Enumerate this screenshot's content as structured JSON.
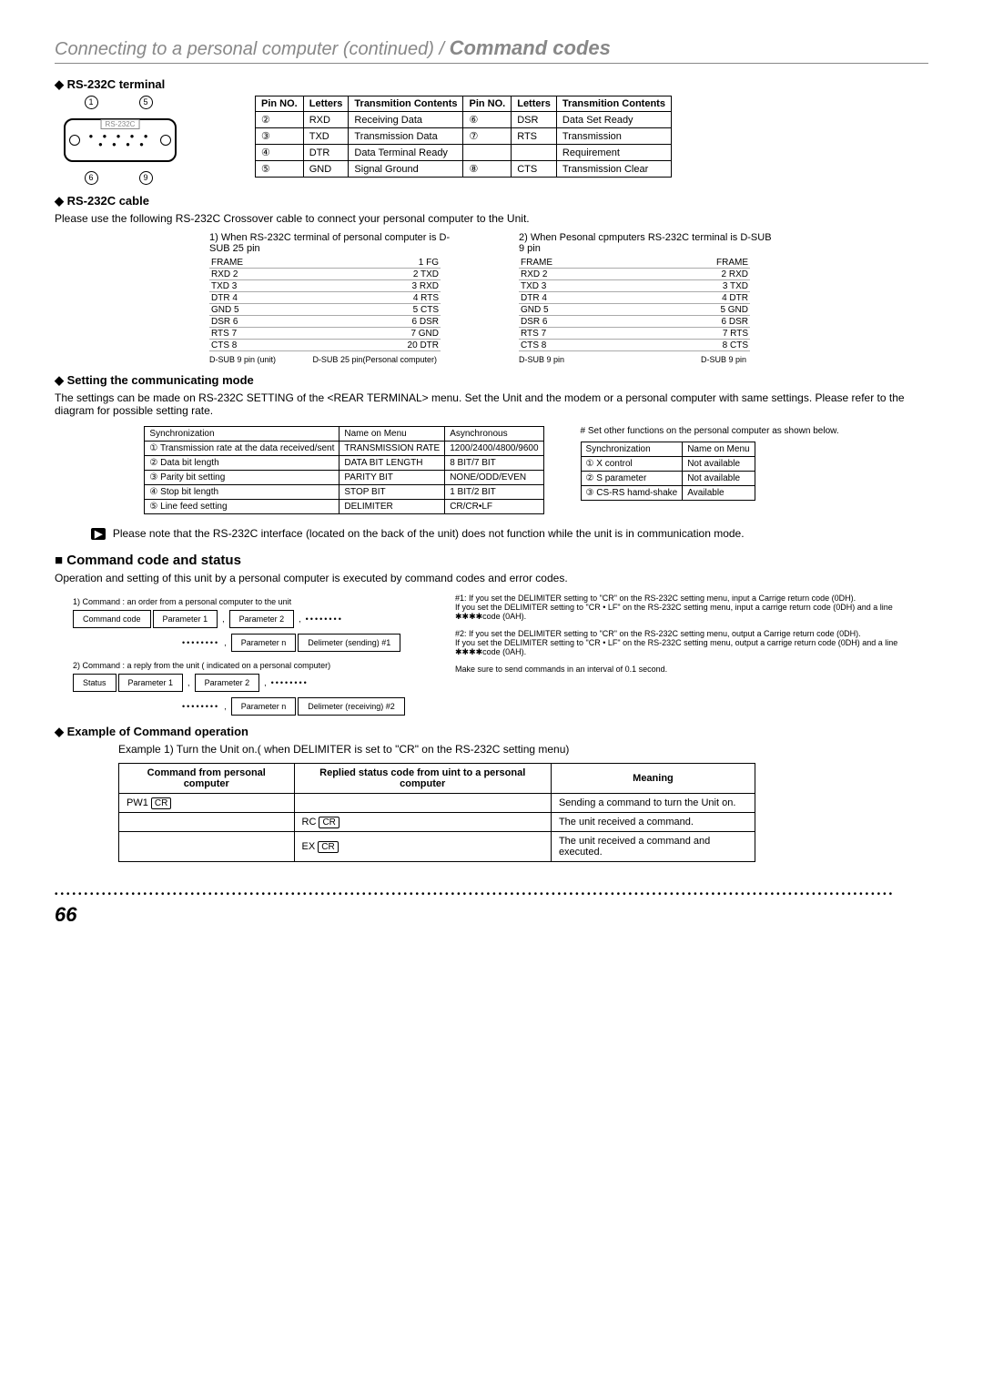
{
  "title_prefix": "Connecting to a personal computer (continued)  / ",
  "title_bold": "Command codes",
  "sections": {
    "rs232_terminal": "RS-232C terminal",
    "rs232_cable": "RS-232C cable",
    "cable_intro": "Please use the following RS-232C Crossover cable to connect your personal computer to the Unit.",
    "wiring1_title": "1) When RS-232C terminal of personal computer is D-SUB 25 pin",
    "wiring2_title": "2) When Pesonal cpmputers RS-232C terminal is D-SUB 9 pin",
    "setting_mode": "Setting the communicating mode",
    "setting_intro": "The settings can be made on RS-232C SETTING of the <REAR TERMINAL> menu. Set the Unit and the modem or a personal computer with same settings. Please refer to the diagram for possible setting rate.",
    "note": "Please note that the RS-232C interface (located on the back of the unit) does not function while the unit is in communication mode.",
    "cmd_status": "Command code and status",
    "cmd_intro": "Operation and setting of this unit by a personal computer is executed by command codes and error codes.",
    "cmd_diag1": "1) Command : an order from a personal computer to the unit",
    "cmd_diag2": "2) Command : a reply from the unit ( indicated on a personal computer)",
    "hash1": "#1: If you set the DELIMITER setting to \"CR\" on the RS-232C setting menu, input a Carrige return code (0DH).\nIf you set the DELIMITER setting to \"CR • LF\" on the RS-232C setting menu, input a carrige return code (0DH) and a line ✱✱✱✱code (0AH).",
    "hash2": "#2: If you set the DELIMITER setting to \"CR\" on the RS-232C setting menu, output a Carrige return code (0DH).\nIf you set the DELIMITER setting to \"CR • LF\" on the RS-232C setting menu, output a carrige return code (0DH) and a line ✱✱✱✱code (0AH).",
    "make_sure": "Make sure to send commands in an interval of 0.1 second.",
    "example_op": "Example of Command operation",
    "example1": "Example 1) Turn the Unit on.( when DELIMITER is set to \"CR\" on the RS-232C setting menu)",
    "other_note": "# Set other functions on the personal computer as shown below."
  },
  "pin_headers": [
    "Pin NO.",
    "Letters",
    "Transmition Contents",
    "Pin NO.",
    "Letters",
    "Transmition Contents"
  ],
  "pin_rows": [
    [
      "②",
      "RXD",
      "Receiving Data",
      "⑥",
      "DSR",
      "Data Set Ready"
    ],
    [
      "③",
      "TXD",
      "Transmission Data",
      "⑦",
      "RTS",
      "Transmission"
    ],
    [
      "④",
      "DTR",
      "Data Terminal Ready",
      "",
      "",
      "Requirement"
    ],
    [
      "⑤",
      "GND",
      "Signal Ground",
      "⑧",
      "CTS",
      "Transmission Clear"
    ]
  ],
  "port_label": "RS-232C",
  "port_top": [
    "①",
    "⑤"
  ],
  "port_bottom": [
    "⑥",
    "⑨"
  ],
  "wiring1": {
    "left": [
      "FRAME",
      "RXD 2",
      "TXD 3",
      "DTR 4",
      "GND 5",
      "DSR 6",
      "RTS 7",
      "CTS 8"
    ],
    "right": [
      "1 FG",
      "2 TXD",
      "3 RXD",
      "4 RTS",
      "5 CTS",
      "6 DSR",
      "7 GND",
      "20 DTR"
    ],
    "lbl_left": "D-SUB 9 pin (unit)",
    "lbl_right": "D-SUB 25 pin(Personal computer)"
  },
  "wiring2": {
    "left": [
      "FRAME",
      "RXD 2",
      "TXD 3",
      "DTR 4",
      "GND 5",
      "DSR 6",
      "RTS 7",
      "CTS 8"
    ],
    "right": [
      "FRAME",
      "2 RXD",
      "3 TXD",
      "4 DTR",
      "5 GND",
      "6 DSR",
      "7 RTS",
      "8 CTS"
    ],
    "lbl_left": "D-SUB 9 pin",
    "lbl_right": "D-SUB 9 pin"
  },
  "setting_headers": [
    "Synchronization",
    "Name on Menu",
    "Asynchronous"
  ],
  "setting_rows": [
    [
      "① Transmission rate at the data received/sent",
      "TRANSMISSION RATE",
      "1200/2400/4800/9600"
    ],
    [
      "② Data bit length",
      "DATA BIT LENGTH",
      "8 BIT/7 BIT"
    ],
    [
      "③ Parity bit setting",
      "PARITY BIT",
      "NONE/ODD/EVEN"
    ],
    [
      "④ Stop bit length",
      "STOP BIT",
      "1 BIT/2 BIT"
    ],
    [
      "⑤ Line feed setting",
      "DELIMITER",
      "CR/CR•LF"
    ]
  ],
  "other_headers": [
    "Synchronization",
    "Name on Menu"
  ],
  "other_rows": [
    [
      "① X control",
      "Not available"
    ],
    [
      "② S parameter",
      "Not available"
    ],
    [
      "③ CS-RS hamd-shake",
      "Available"
    ]
  ],
  "flow_labels": {
    "cmd_code": "Command code",
    "status": "Status",
    "p1": "Parameter 1",
    "p2": "Parameter 2",
    "pn": "Parameter n",
    "del_send": "Delimeter (sending) #1",
    "del_recv": "Delimeter (receiving) #2"
  },
  "example_headers": [
    "Command from personal computer",
    "Replied status code from uint to a personal computer",
    "Meaning"
  ],
  "example_rows": [
    [
      "PW1",
      "CR",
      "",
      "",
      "Sending a command to turn the Unit on."
    ],
    [
      "",
      "",
      "RC",
      "CR",
      "The unit received a command."
    ],
    [
      "",
      "",
      "EX",
      "CR",
      "The unit received a command and executed."
    ]
  ],
  "page_number": "66"
}
